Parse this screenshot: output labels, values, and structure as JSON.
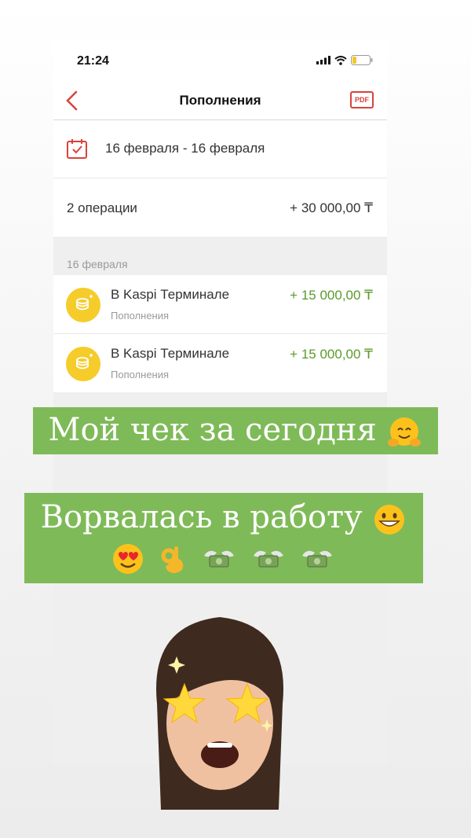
{
  "status": {
    "time": "21:24"
  },
  "header": {
    "title": "Пополнения",
    "pdf_label": "PDF"
  },
  "filter": {
    "date_range": "16 февраля - 16 февраля"
  },
  "summary": {
    "operations": "2 операции",
    "total": "+ 30 000,00 ₸"
  },
  "section": {
    "date": "16 февраля"
  },
  "transactions": [
    {
      "title": "В Kaspi Терминале",
      "category": "Пополнения",
      "amount": "+ 15 000,00 ₸"
    },
    {
      "title": "В Kaspi Терминале",
      "category": "Пополнения",
      "amount": "+ 15 000,00 ₸"
    }
  ],
  "overlay": {
    "caption1": "Мой чек за сегодня",
    "caption2_line1": "Ворвалась в работу",
    "emoji_icons": [
      "hugging-face-icon",
      "grinning-face-icon",
      "heart-eyes-icon",
      "ok-hand-icon",
      "money-wings-icon"
    ]
  },
  "colors": {
    "accent_red": "#d9433b",
    "amount_green": "#5a9a2c",
    "coin_yellow": "#f5cc2a",
    "sticker_green": "#7fba58"
  }
}
